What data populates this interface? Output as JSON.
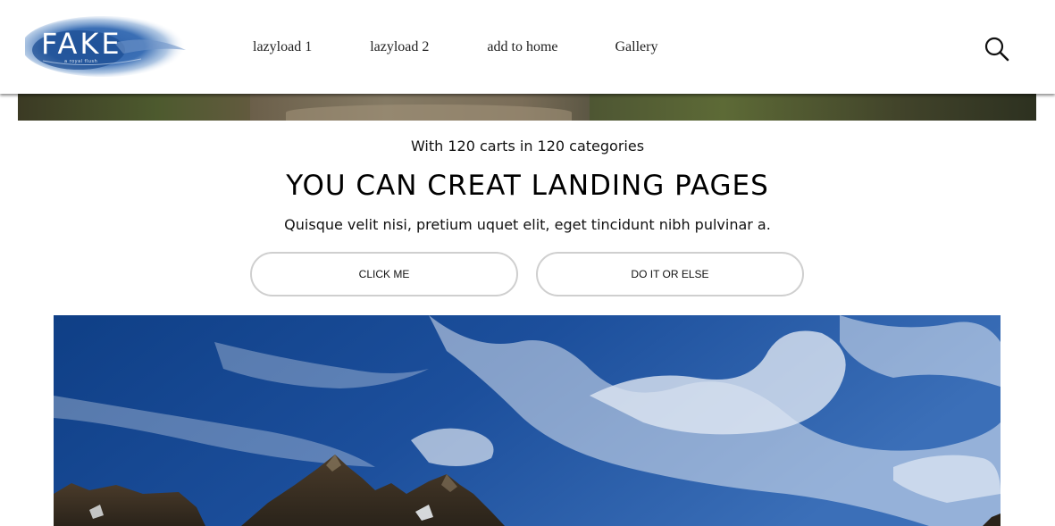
{
  "brand": {
    "logo_text": "FAKE",
    "tagline": "a royal flush"
  },
  "nav": {
    "items": [
      {
        "label": "lazyload 1"
      },
      {
        "label": "lazyload 2"
      },
      {
        "label": "add to home"
      },
      {
        "label": "Gallery"
      }
    ],
    "search_icon": "search-icon"
  },
  "hero": {
    "subheading": "With 120 carts in 120 categories",
    "heading": "YOU CAN CREAT LANDING PAGES",
    "lead": "Quisque velit nisi, pretium uquet elit, eget tincidunt nibh pulvinar a.",
    "buttons": [
      {
        "label": "CLICK ME"
      },
      {
        "label": "DO IT OR ELSE"
      }
    ]
  },
  "colors": {
    "text": "#111111",
    "button_border": "#cfcfcf",
    "sky": "#1d4f9a"
  }
}
